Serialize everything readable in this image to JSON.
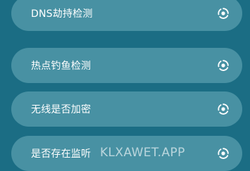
{
  "items": [
    {
      "label": "DNS劫持检测",
      "icon": "scan-icon"
    },
    {
      "label": "热点钓鱼检测",
      "icon": "scan-icon"
    },
    {
      "label": "无线是否加密",
      "icon": "scan-icon"
    },
    {
      "label": "是否存在监听",
      "icon": "scan-icon"
    }
  ],
  "watermark": "KLXAWET.APP",
  "colors": {
    "background": "#1b6d84",
    "item_background": "#87c3d0",
    "text": "#ffffff"
  }
}
